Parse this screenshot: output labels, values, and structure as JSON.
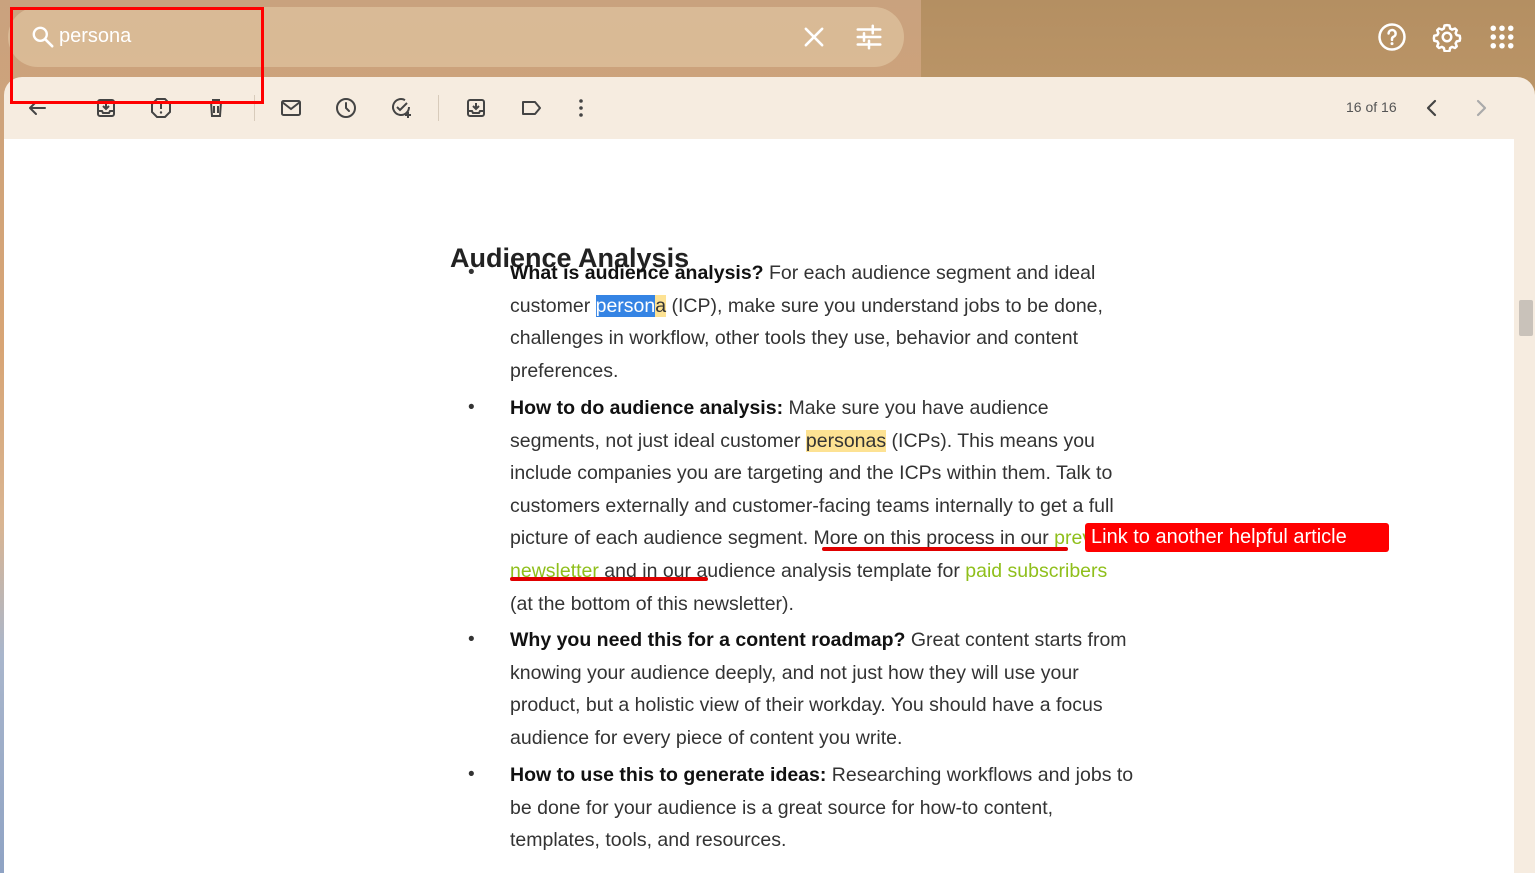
{
  "search": {
    "query": "persona"
  },
  "toolbar": {
    "pager_text": "16 of 16"
  },
  "article": {
    "title": "Audience Analysis",
    "items": [
      {
        "lead": "What is audience analysis?",
        "p1": " For each audience segment and ideal customer ",
        "sel": "person",
        "hl": "a",
        "p2": " (ICP), make sure you understand jobs to be done, challenges in workflow, other tools they use, behavior and content preferences."
      },
      {
        "lead": "How to do audience analysis:",
        "p1": " Make sure you have audience segments, not just ideal customer ",
        "hl": "personas",
        "p2": " (ICPs). This means you include companies you are targeting and the ICPs within them. Talk to customers externally and customer-facing teams internally to get a full picture of each audience segment. More on this process in our ",
        "link1": "previous newsletter",
        "p3": " and in our audience analysis template for ",
        "link2": "paid subscribers",
        "p4": " (at the bottom of this newsletter)."
      },
      {
        "lead": "Why you need this for a content roadmap?",
        "p1": " Great content starts from knowing your audience deeply, and not just how they will use your product, but a holistic view of their workday. You should have a focus audience for every piece of content you write."
      },
      {
        "lead": "How to use this to generate ideas:",
        "p1": " Researching workflows and jobs to be done for your audience is a great source for how-to content, templates, tools, and resources."
      }
    ]
  },
  "annotation": {
    "callout_text": "Link to another helpful article"
  },
  "colors": {
    "highlight": "#fde293",
    "selection": "#3584e4",
    "link": "#8fbf1b",
    "annotation": "#ff0000"
  }
}
